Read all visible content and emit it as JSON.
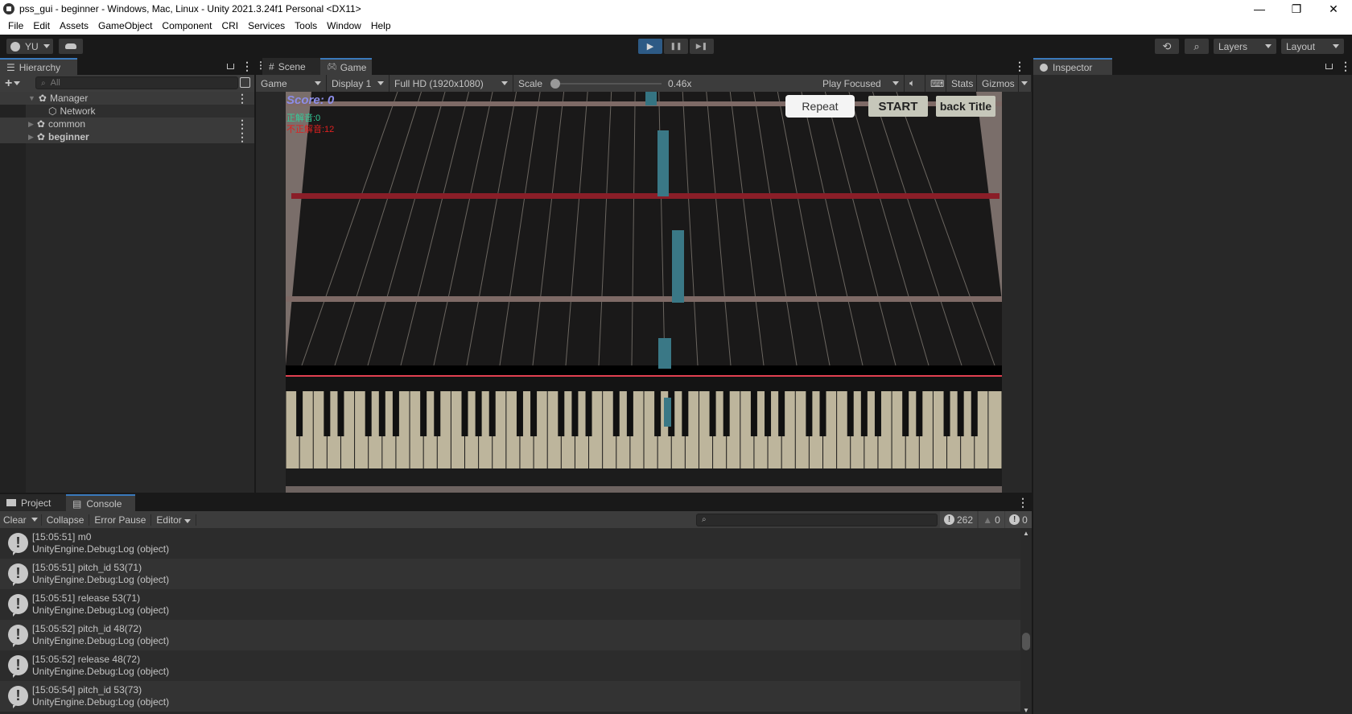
{
  "window": {
    "title": "pss_gui - beginner - Windows, Mac, Linux - Unity 2021.3.24f1 Personal <DX11>",
    "minimize": "—",
    "restore": "❐",
    "close": "✕"
  },
  "menu": [
    "File",
    "Edit",
    "Assets",
    "GameObject",
    "Component",
    "CRI",
    "Services",
    "Tools",
    "Window",
    "Help"
  ],
  "toolbar": {
    "account": "YU",
    "cloud_icon": "cloud-icon",
    "play_icon": "▶",
    "pause_icon": "❚❚",
    "step_icon": "▶❚",
    "history_icon": "history-icon",
    "search_icon": "search-icon",
    "layers": "Layers",
    "layout": "Layout"
  },
  "hierarchy": {
    "tab": "Hierarchy",
    "search_placeholder": "All",
    "items": [
      {
        "label": "Manager",
        "expanded": true
      },
      {
        "label": "Network",
        "child": true
      },
      {
        "label": "common",
        "expanded": false
      },
      {
        "label": "beginner",
        "expanded": false
      }
    ]
  },
  "game_view": {
    "tabs": [
      "Scene",
      "Game"
    ],
    "active_tab": "Game",
    "mode": "Game",
    "display": "Display 1",
    "resolution": "Full HD (1920x1080)",
    "scale_label": "Scale",
    "scale_value": "0.46x",
    "play_mode": "Play Focused",
    "stats": "Stats",
    "gizmos": "Gizmos",
    "hud": {
      "score": "Score: 0",
      "correct": "正解音:0",
      "incorrect": "不正解音:12"
    },
    "buttons": {
      "repeat": "Repeat",
      "start": "START",
      "back": "back Title"
    }
  },
  "inspector": {
    "tab": "Inspector"
  },
  "console": {
    "tabs": [
      "Project",
      "Console"
    ],
    "active_tab": "Console",
    "clear": "Clear",
    "collapse": "Collapse",
    "error_pause": "Error Pause",
    "editor": "Editor",
    "search_placeholder": "",
    "counts": {
      "log": "262",
      "warning": "0",
      "error": "0"
    },
    "entries": [
      {
        "line1": "[15:05:51] m0",
        "line2": "UnityEngine.Debug:Log (object)"
      },
      {
        "line1": "[15:05:51] pitch_id 53(71)",
        "line2": "UnityEngine.Debug:Log (object)"
      },
      {
        "line1": "[15:05:51] release 53(71)",
        "line2": "UnityEngine.Debug:Log (object)"
      },
      {
        "line1": "[15:05:52] pitch_id 48(72)",
        "line2": "UnityEngine.Debug:Log (object)"
      },
      {
        "line1": "[15:05:52] release 48(72)",
        "line2": "UnityEngine.Debug:Log (object)"
      },
      {
        "line1": "[15:05:54] pitch_id 53(73)",
        "line2": "UnityEngine.Debug:Log (object)"
      }
    ]
  }
}
